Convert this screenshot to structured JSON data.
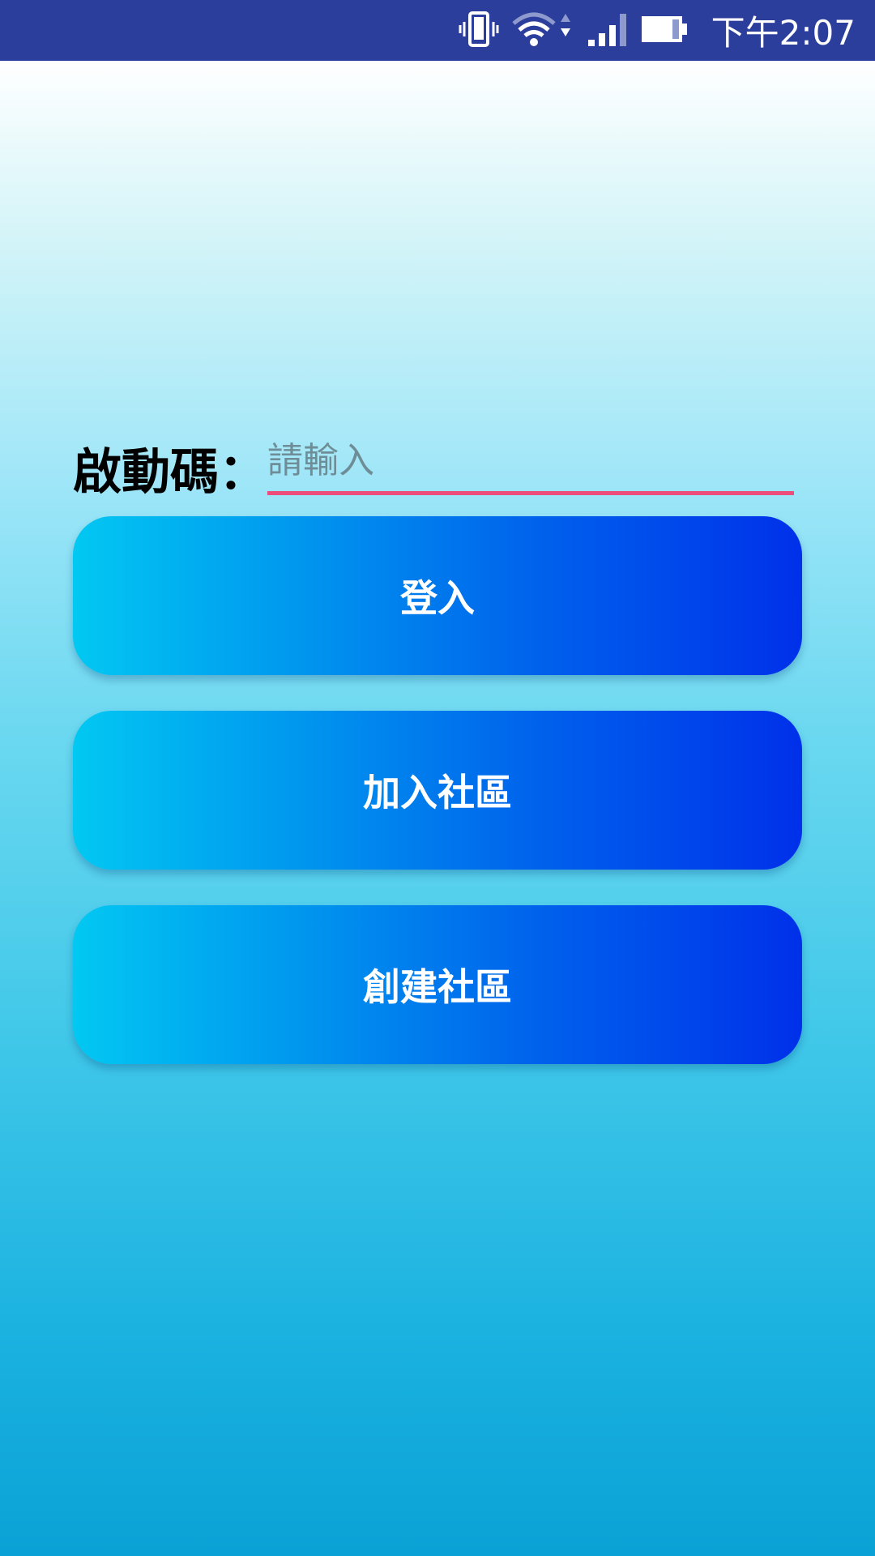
{
  "status_bar": {
    "time": "下午2:07",
    "icons": [
      "vibrate-icon",
      "wifi-icon",
      "signal-icon",
      "battery-icon"
    ],
    "background": "#2B3E9C"
  },
  "form": {
    "label": "啟動碼：",
    "placeholder": "請輸入",
    "value": "",
    "underline_color": "#EC4D7A"
  },
  "buttons": {
    "login": "登入",
    "join_community": "加入社區",
    "create_community": "創建社區"
  },
  "colors": {
    "button_gradient_start": "#02C8F2",
    "button_gradient_end": "#0030EA",
    "background_top": "#FFFFFF",
    "background_bottom": "#0AA2D6"
  }
}
